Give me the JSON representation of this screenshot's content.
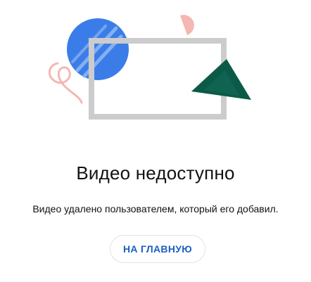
{
  "message": {
    "title": "Видео недоступно",
    "description": "Видео удалено пользователем, который его добавил."
  },
  "actions": {
    "home_label": "НА ГЛАВНУЮ"
  },
  "illustration": {
    "colors": {
      "circle": "#3b7de8",
      "circle_stripe": "#8fb5f2",
      "frame": "#cccccc",
      "triangle": "#0b5a48",
      "accent_pink": "#f5b7b1"
    }
  }
}
